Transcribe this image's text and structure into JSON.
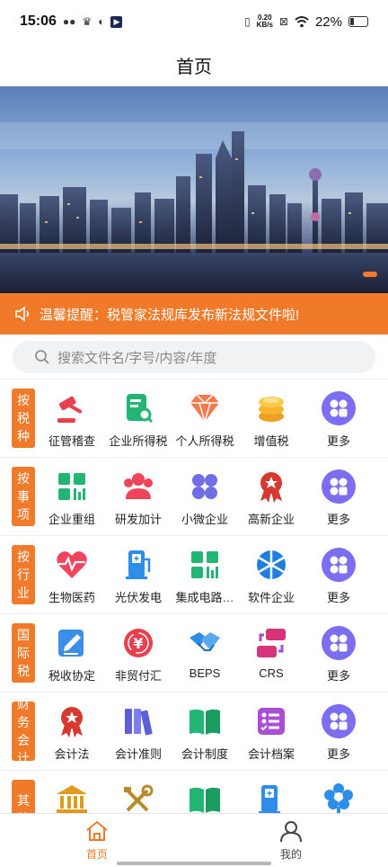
{
  "status": {
    "time": "15:06",
    "net_speed_value": "0.20",
    "net_speed_unit": "KB/s",
    "battery": "22%",
    "battery_level": 0.22
  },
  "header": {
    "title": "首页"
  },
  "notice": {
    "text": "温馨提醒：税管家法规库发布新法规文件啦!"
  },
  "search": {
    "placeholder": "搜索文件名/字号/内容/年度"
  },
  "categories": [
    {
      "label": "按税种",
      "items": [
        "征管稽查",
        "企业所得税",
        "个人所得税",
        "增值税",
        "更多"
      ]
    },
    {
      "label": "按事项",
      "items": [
        "企业重组",
        "研发加计",
        "小微企业",
        "高新企业",
        "更多"
      ]
    },
    {
      "label": "按行业",
      "items": [
        "生物医药",
        "光伏发电",
        "集成电路…",
        "软件企业",
        "更多"
      ]
    },
    {
      "label": "国际税",
      "items": [
        "税收协定",
        "非贸付汇",
        "BEPS",
        "CRS",
        "更多"
      ]
    },
    {
      "label": "财务会计",
      "items": [
        "会计法",
        "会计准则",
        "会计制度",
        "会计档案",
        "更多"
      ]
    },
    {
      "label": "其他",
      "items": [
        "",
        "",
        "",
        "",
        ""
      ]
    }
  ],
  "tabs": {
    "home": "首页",
    "mine": "我的"
  },
  "colors": {
    "accent": "#f07a2a",
    "more_icon": "#7b6ef0"
  }
}
